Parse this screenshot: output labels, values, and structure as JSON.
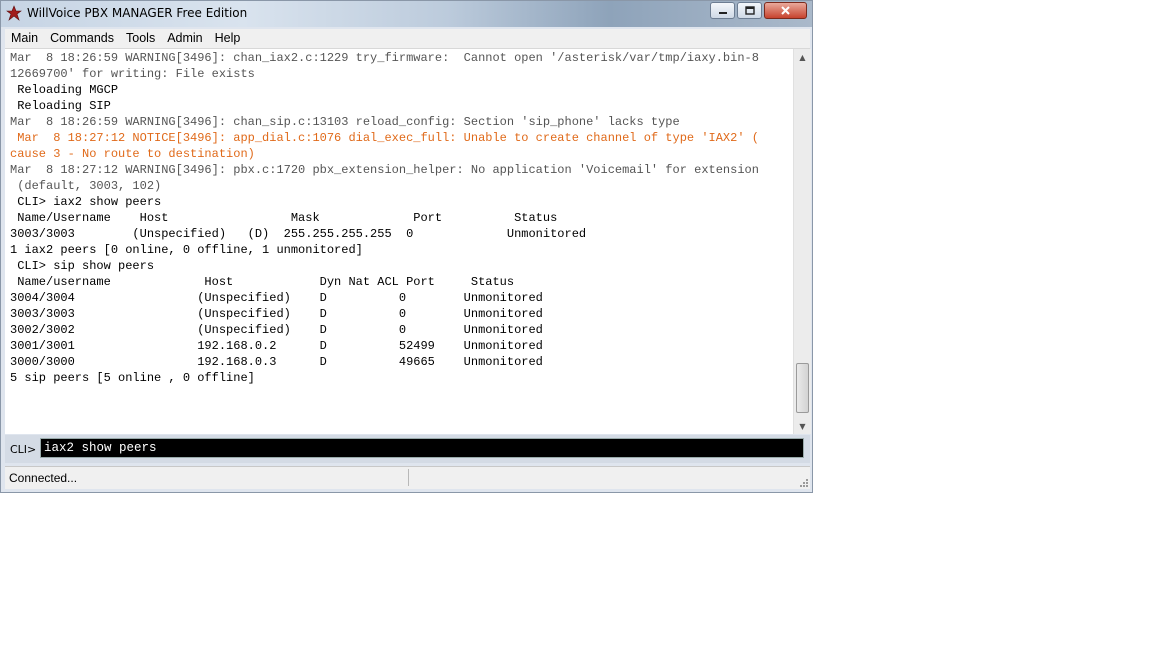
{
  "window": {
    "title": "WillVoice PBX MANAGER Free Edition",
    "minimize_glyph": "—",
    "maximize_glyph": "□",
    "close_glyph": "✕"
  },
  "menu": [
    "Main",
    "Commands",
    "Tools",
    "Admin",
    "Help"
  ],
  "console": {
    "lines": [
      {
        "text": "Mar  8 18:26:59 WARNING[3496]: chan_iax2.c:1229 try_firmware:  Cannot open '/asterisk/var/tmp/iaxy.bin-8",
        "color": "#555555"
      },
      {
        "text": "12669700' for writing: File exists",
        "color": "#555555"
      },
      {
        "text": " Reloading MGCP",
        "color": "#000000"
      },
      {
        "text": " Reloading SIP",
        "color": "#000000"
      },
      {
        "text": "Mar  8 18:26:59 WARNING[3496]: chan_sip.c:13103 reload_config: Section 'sip_phone' lacks type",
        "color": "#555555"
      },
      {
        "text": " Mar  8 18:27:12 NOTICE[3496]: app_dial.c:1076 dial_exec_full: Unable to create channel of type 'IAX2' (",
        "color": "#e06a1a"
      },
      {
        "text": "cause 3 - No route to destination)",
        "color": "#e06a1a"
      },
      {
        "text": "Mar  8 18:27:12 WARNING[3496]: pbx.c:1720 pbx_extension_helper: No application 'Voicemail' for extension",
        "color": "#555555"
      },
      {
        "text": " (default, 3003, 102)",
        "color": "#555555"
      },
      {
        "text": " CLI> iax2 show peers",
        "color": "#000000"
      },
      {
        "text": " Name/Username    Host                 Mask             Port          Status",
        "color": "#000000"
      },
      {
        "text": "3003/3003        (Unspecified)   (D)  255.255.255.255  0             Unmonitored",
        "color": "#000000"
      },
      {
        "text": "1 iax2 peers [0 online, 0 offline, 1 unmonitored]",
        "color": "#000000"
      },
      {
        "text": " CLI> sip show peers",
        "color": "#000000"
      },
      {
        "text": " Name/username             Host            Dyn Nat ACL Port     Status",
        "color": "#000000"
      },
      {
        "text": "3004/3004                 (Unspecified)    D          0        Unmonitored",
        "color": "#000000"
      },
      {
        "text": "3003/3003                 (Unspecified)    D          0        Unmonitored",
        "color": "#000000"
      },
      {
        "text": "3002/3002                 (Unspecified)    D          0        Unmonitored",
        "color": "#000000"
      },
      {
        "text": "3001/3001                 192.168.0.2      D          52499    Unmonitored",
        "color": "#000000"
      },
      {
        "text": "3000/3000                 192.168.0.3      D          49665    Unmonitored",
        "color": "#000000"
      },
      {
        "text": "5 sip peers [5 online , 0 offline]",
        "color": "#000000"
      }
    ]
  },
  "cli": {
    "label": "CLI>",
    "value": "iax2 show peers"
  },
  "status": {
    "text": "Connected..."
  },
  "icons": {
    "app": "asterisk-logo-icon",
    "scroll_up": "scroll-up-arrow-icon",
    "scroll_down": "scroll-down-arrow-icon"
  },
  "colors": {
    "warning_text": "#555555",
    "notice_text": "#e06a1a",
    "cli_input_bg": "#000000"
  }
}
